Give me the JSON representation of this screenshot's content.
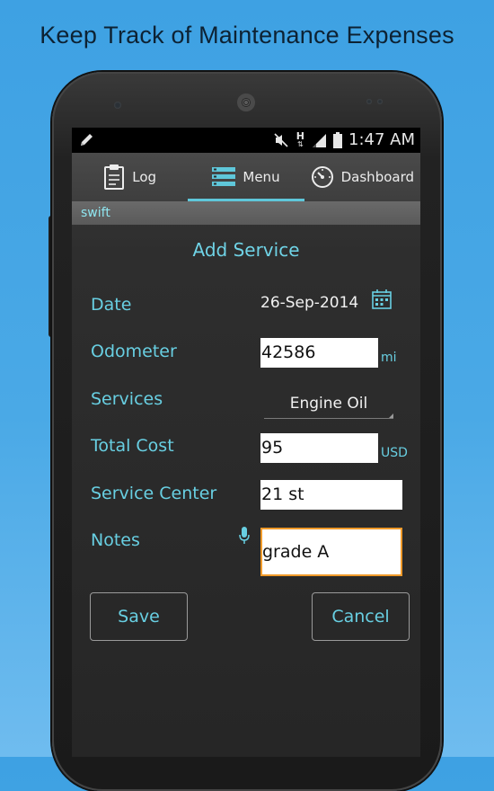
{
  "promo": {
    "title": "Keep Track of Maintenance Expenses"
  },
  "status_bar": {
    "time": "1:47 AM",
    "h_indicator": "H"
  },
  "tabs": [
    {
      "label": "Log",
      "icon": "clipboard-icon"
    },
    {
      "label": "Menu",
      "icon": "menu-list-icon"
    },
    {
      "label": "Dashboard",
      "icon": "speedometer-icon"
    }
  ],
  "vehicle": {
    "name": "swift"
  },
  "form": {
    "title": "Add Service",
    "date": {
      "label": "Date",
      "value": "26-Sep-2014"
    },
    "odometer": {
      "label": "Odometer",
      "value": "42586",
      "unit": "mi"
    },
    "services": {
      "label": "Services",
      "value": "Engine Oil"
    },
    "total_cost": {
      "label": "Total Cost",
      "value": "95",
      "unit": "USD"
    },
    "service_center": {
      "label": "Service Center",
      "value": "21 st"
    },
    "notes": {
      "label": "Notes",
      "value": "grade A"
    }
  },
  "buttons": {
    "save": "Save",
    "cancel": "Cancel"
  },
  "colors": {
    "accent": "#68cfe2",
    "focus": "#f09a2a",
    "background": "#3ea1e3"
  }
}
